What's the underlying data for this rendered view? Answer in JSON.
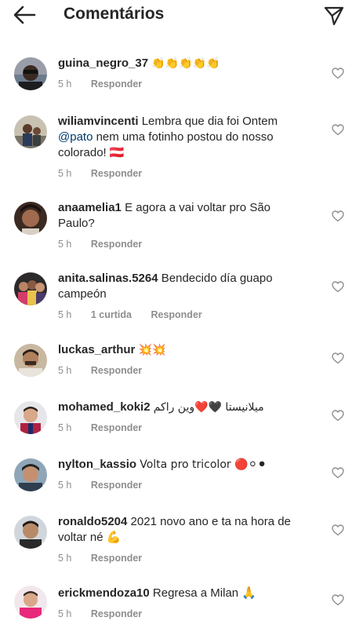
{
  "header": {
    "title": "Comentários"
  },
  "comments": [
    {
      "username": "guina_negro_37",
      "text": "👏👏👏👏👏",
      "time": "5 h",
      "likes": "",
      "reply": "Responder"
    },
    {
      "username": "wiliamvincenti",
      "text": "Lembra que dia foi Ontem",
      "mention": "@pato",
      "text2": "nem uma fotinho postou do nosso colorado! 🇦🇹",
      "time": "5 h",
      "likes": "",
      "reply": "Responder"
    },
    {
      "username": "anaamelia1",
      "text": "E agora a  vai voltar pro São Paulo?",
      "time": "5 h",
      "likes": "",
      "reply": "Responder"
    },
    {
      "username": "anita.salinas.5264",
      "text": "Bendecido día guapo campeón",
      "time": "5 h",
      "likes": "1 curtida",
      "reply": "Responder"
    },
    {
      "username": "luckas_arthur",
      "text": "💥💥",
      "time": "5 h",
      "likes": "",
      "reply": "Responder"
    },
    {
      "username": "mohamed_koki2",
      "text": "ميلانيستا 🖤❤️وين راكم",
      "time": "5 h",
      "likes": "",
      "reply": "Responder"
    },
    {
      "username": "nylton_kassio",
      "text": "Volta pro tricolor 🔴⚪⚫",
      "time": "5 h",
      "likes": "",
      "reply": "Responder"
    },
    {
      "username": "ronaldo5204",
      "text": "2021 novo ano e ta na hora de voltar né 💪",
      "time": "5 h",
      "likes": "",
      "reply": "Responder"
    },
    {
      "username": "erickmendoza10",
      "text": "Regresa a Milan 🙏",
      "time": "5 h",
      "likes": "",
      "reply": "Responder"
    }
  ],
  "colors": {
    "text": "#262626",
    "meta": "#8e8e8e",
    "mention": "#00376b",
    "background": "#ffffff"
  },
  "icons": {
    "back": "arrow-left-icon",
    "send": "paper-plane-icon",
    "like": "heart-outline-icon"
  }
}
